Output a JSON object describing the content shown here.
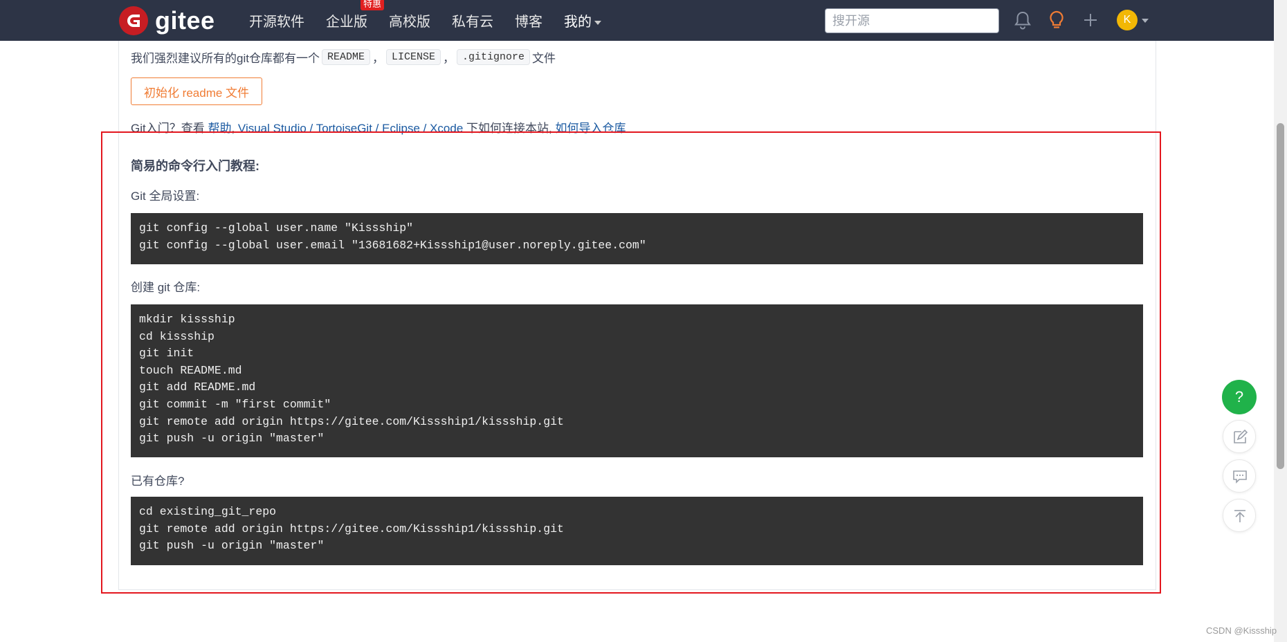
{
  "header": {
    "brand": "gitee",
    "nav": [
      {
        "label": "开源软件"
      },
      {
        "label": "企业版",
        "badge": "特惠"
      },
      {
        "label": "高校版"
      },
      {
        "label": "私有云"
      },
      {
        "label": "博客"
      },
      {
        "label": "我的"
      }
    ],
    "search_placeholder": "搜开源",
    "avatar_letter": "K",
    "icons": [
      "bell-icon",
      "bulb-icon",
      "plus-icon",
      "avatar",
      "chevron-down-icon"
    ],
    "accent_orange": "#f07c34",
    "bar_color": "#2d3446"
  },
  "readme": {
    "prefix": "我们强烈建议所有的git仓库都有一个",
    "files": [
      "README",
      "LICENSE",
      ".gitignore"
    ],
    "sep": "，",
    "suffix": "文件",
    "init_button": "初始化 readme 文件"
  },
  "help": {
    "prefix": "Git入门？查看 ",
    "link_help": "帮助",
    "sep": ", ",
    "link_tools": "Visual Studio / TortoiseGit / Eclipse / Xcode",
    "middle": " 下如何连接本站, ",
    "link_import": "如何导入仓库"
  },
  "tutorial": {
    "title": "简易的命令行入门教程:",
    "sections": [
      {
        "label": "Git 全局设置:",
        "code": [
          "git config --global user.name \"Kissship\"",
          "git config --global user.email \"13681682+Kissship1@user.noreply.gitee.com\""
        ]
      },
      {
        "label": "创建 git 仓库:",
        "code": [
          "mkdir kissship",
          "cd kissship",
          "git init",
          "touch README.md",
          "git add README.md",
          "git commit -m \"first commit\"",
          "git remote add origin https://gitee.com/Kissship1/kissship.git",
          "git push -u origin \"master\""
        ]
      },
      {
        "label": "已有仓库?",
        "code": [
          "cd existing_git_repo",
          "git remote add origin https://gitee.com/Kissship1/kissship.git",
          "git push -u origin \"master\""
        ]
      }
    ],
    "highlight_color": "#e3161e"
  },
  "floating": {
    "help": "?",
    "tools": [
      "edit-icon",
      "comment-icon",
      "back-to-top-icon"
    ],
    "help_color": "#20b24a"
  },
  "watermark": "CSDN @Kissship"
}
